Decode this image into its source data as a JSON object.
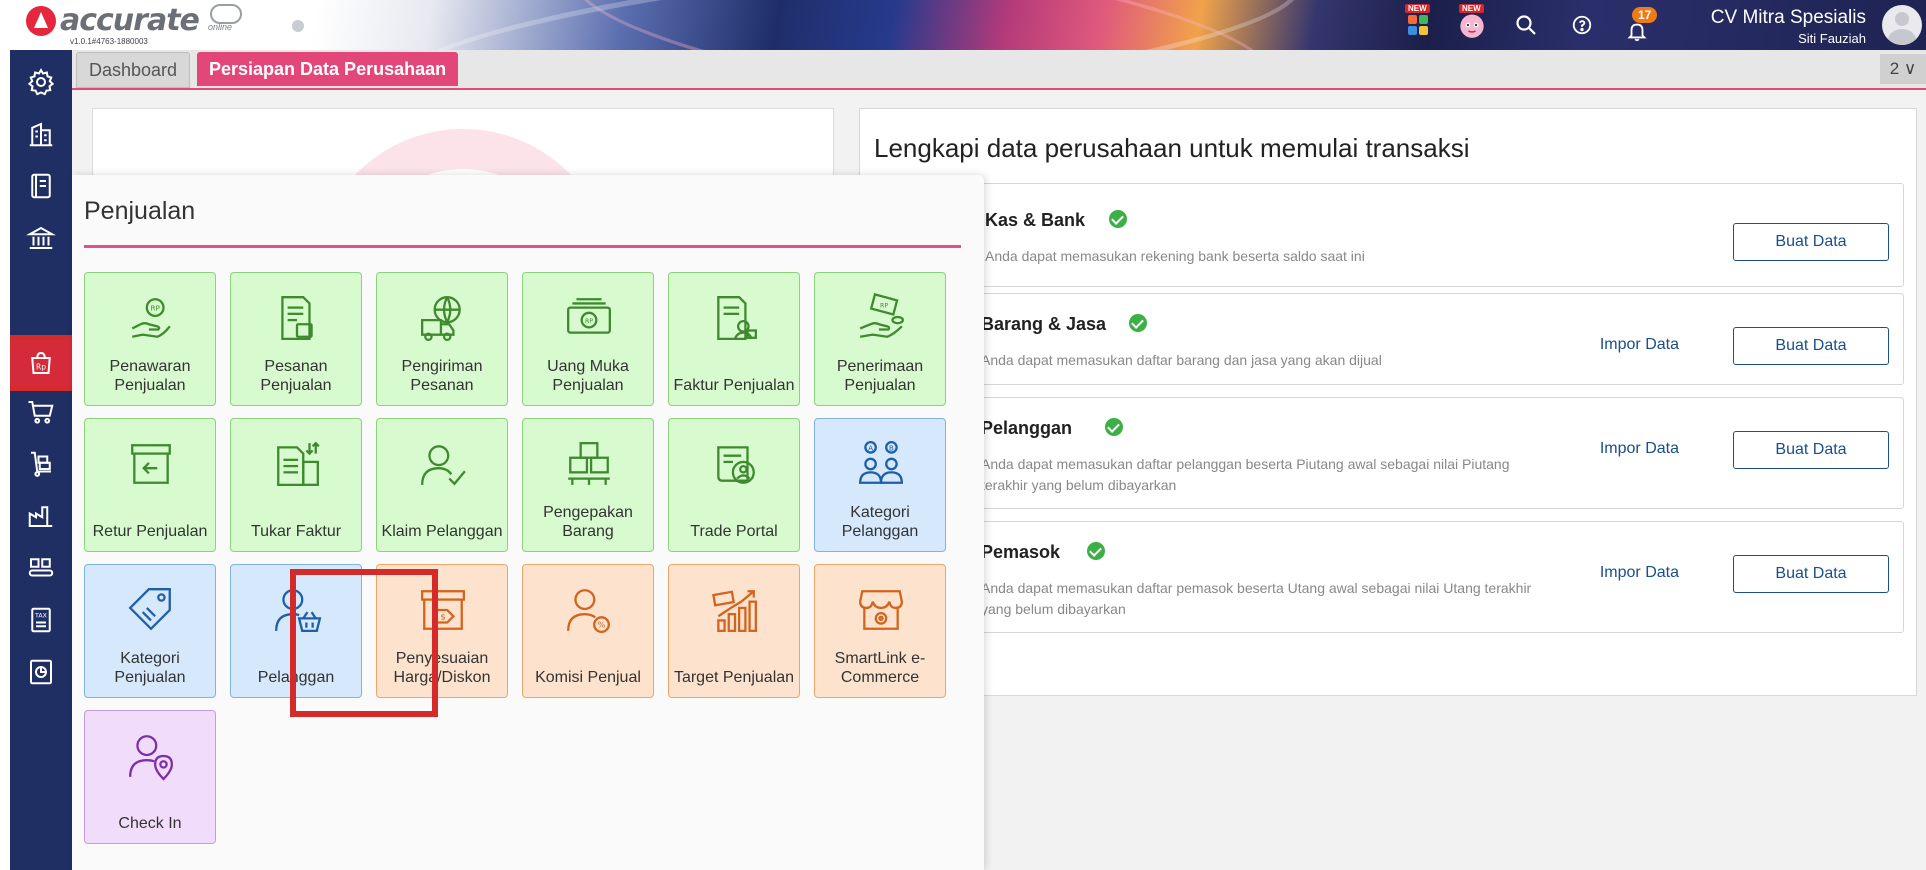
{
  "app": {
    "logo_text": "accurate",
    "logo_sub": "online",
    "version": "v1.0.1#4763-1880003"
  },
  "topbar": {
    "new_badge": "NEW",
    "notification_count": "17",
    "company_name": "CV Mitra Spesialis",
    "user_name": "Siti Fauziah"
  },
  "tabs": {
    "dashboard": "Dashboard",
    "persiapan": "Persiapan Data Perusahaan",
    "count": "2 ∨"
  },
  "flyout": {
    "title": "Penjualan",
    "tiles": [
      {
        "label": "Penawaran Penjualan",
        "color": "green",
        "icon": "quote-hand-icon"
      },
      {
        "label": "Pesanan Penjualan",
        "color": "green",
        "icon": "order-doc-icon"
      },
      {
        "label": "Pengiriman Pesanan",
        "color": "green",
        "icon": "delivery-truck-icon"
      },
      {
        "label": "Uang Muka Penjualan",
        "color": "green",
        "icon": "money-icon"
      },
      {
        "label": "Faktur Penjualan",
        "color": "green",
        "icon": "invoice-icon"
      },
      {
        "label": "Penerimaan Penjualan",
        "color": "green",
        "icon": "payment-hand-icon"
      },
      {
        "label": "Retur Penjualan",
        "color": "green",
        "icon": "return-box-icon"
      },
      {
        "label": "Tukar Faktur",
        "color": "green",
        "icon": "swap-invoice-icon"
      },
      {
        "label": "Klaim Pelanggan",
        "color": "green",
        "icon": "customer-check-icon"
      },
      {
        "label": "Pengepakan Barang",
        "color": "green",
        "icon": "packing-boxes-icon"
      },
      {
        "label": "Trade Portal",
        "color": "green",
        "icon": "trade-portal-icon"
      },
      {
        "label": "Kategori Pelanggan",
        "color": "blue",
        "icon": "customer-category-icon"
      },
      {
        "label": "Kategori Penjualan",
        "color": "blue",
        "icon": "sales-category-icon"
      },
      {
        "label": "Pelanggan",
        "color": "blue",
        "icon": "customer-basket-icon"
      },
      {
        "label": "Penyesuaian Harga/Diskon",
        "color": "orange",
        "icon": "price-adjust-icon"
      },
      {
        "label": "Komisi Penjual",
        "color": "orange",
        "icon": "commission-icon"
      },
      {
        "label": "Target Penjualan",
        "color": "orange",
        "icon": "sales-target-icon"
      },
      {
        "label": "SmartLink e-Commerce",
        "color": "orange",
        "icon": "smartlink-store-icon"
      },
      {
        "label": "Check In",
        "color": "purple",
        "icon": "check-in-icon"
      }
    ]
  },
  "setup": {
    "title": "Lengkapi data perusahaan untuk memulai transaksi",
    "impor_label": "Impor Data",
    "buat_label": "Buat Data",
    "cards": [
      {
        "title": "Kas & Bank",
        "desc": "Anda dapat memasukan rekening bank beserta saldo saat ini",
        "has_impor": false
      },
      {
        "title": "Barang & Jasa",
        "desc": "Anda dapat memasukan daftar barang dan jasa yang akan dijual",
        "has_impor": true
      },
      {
        "title": "Pelanggan",
        "desc": "Anda dapat memasukan daftar pelanggan beserta Piutang awal sebagai nilai Piutang terakhir yang belum dibayarkan",
        "has_impor": true
      },
      {
        "title": "Pemasok",
        "desc": "Anda dapat memasukan daftar pemasok beserta Utang awal sebagai nilai Utang terakhir yang belum dibayarkan",
        "has_impor": true
      }
    ]
  },
  "colors": {
    "accent_pink": "#e3477a",
    "sidebar": "#1f2f64",
    "tile_green": "#d7fbce",
    "tile_blue": "#d5e8fc",
    "tile_orange": "#fde3cd",
    "tile_purple": "#f1ddfb",
    "link_blue": "#1a4f8b",
    "check_green": "#3cb044"
  }
}
